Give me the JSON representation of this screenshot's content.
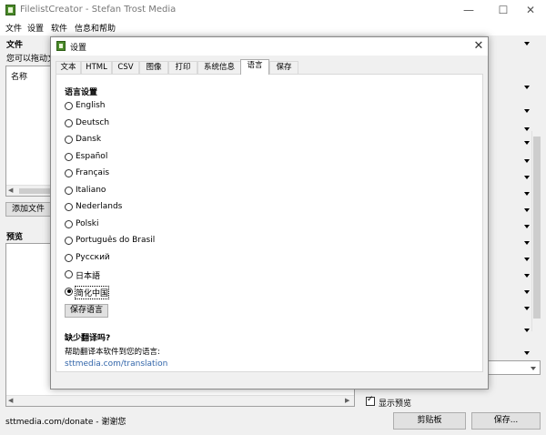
{
  "window": {
    "title": "FilelistCreator - Stefan Trost Media",
    "min_glyph": "—",
    "max_glyph": "☐",
    "close_glyph": "✕"
  },
  "menu": [
    "文件",
    "设置",
    "软件",
    "信息和帮助"
  ],
  "left": {
    "files_label": "文件",
    "hint": "您可以拖动文",
    "column_name": "名称",
    "add_button": "添加文件夹",
    "preview_label": "预览"
  },
  "bottom": {
    "status": "sttmedia.com/donate - 谢谢您",
    "show_preview": "显示预览",
    "clipboard_button": "剪贴板",
    "save_button": "保存..."
  },
  "dialog": {
    "title": "设置",
    "close_glyph": "✕",
    "tabs": [
      "文本",
      "HTML",
      "CSV",
      "图像",
      "打印",
      "系统信息",
      "语言",
      "保存"
    ],
    "active_tab": "语言",
    "language_heading": "语言设置",
    "languages": [
      "English",
      "Deutsch",
      "Dansk",
      "Español",
      "Français",
      "Italiano",
      "Nederlands",
      "Polski",
      "Português do Brasil",
      "Русский",
      "日本語",
      "简化中国"
    ],
    "selected_language": "简化中国",
    "save_language_button": "保存语言",
    "missing_heading": "缺少翻译吗?",
    "help_text": "帮助翻译本软件到您的语言:",
    "help_link": "sttmedia.com/translation"
  },
  "colors": {
    "link": "#3366aa",
    "dialog_bg": "#f0f0f0",
    "panel_bg": "#ffffff",
    "icon_green": "#4a8a2a"
  }
}
